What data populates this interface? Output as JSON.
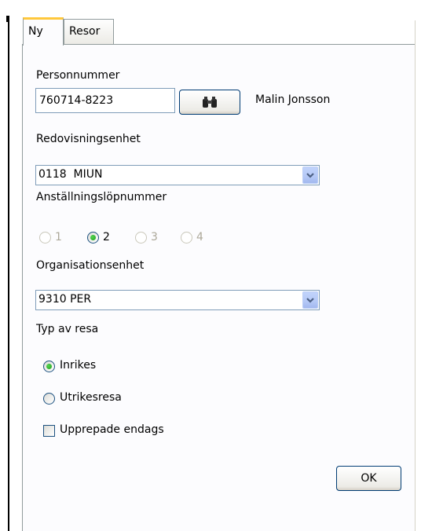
{
  "tabs": [
    {
      "label": "Ny"
    },
    {
      "label": "Resor"
    }
  ],
  "form": {
    "personnummer_label": "Personnummer",
    "personnummer_value": "760714-8223",
    "search_icon": "binoculars-icon",
    "person_name": "Malin Jonsson",
    "redovisningsenhet_label": "Redovisningsenhet",
    "redovisningsenhet_value": "0118  MIUN",
    "anstallning_label": "Anställningslöpnummer",
    "anstallning_options": [
      {
        "label": "1",
        "selected": false,
        "enabled": false
      },
      {
        "label": "2",
        "selected": true,
        "enabled": true
      },
      {
        "label": "3",
        "selected": false,
        "enabled": false
      },
      {
        "label": "4",
        "selected": false,
        "enabled": false
      }
    ],
    "organisationsenhet_label": "Organisationsenhet",
    "organisationsenhet_value": "9310 PER",
    "typ_av_resa_label": "Typ av resa",
    "typ_options": [
      {
        "label": "Inrikes",
        "selected": true
      },
      {
        "label": "Utrikesresa",
        "selected": false
      }
    ],
    "upprepade_label": "Upprepade endags",
    "upprepade_checked": false,
    "ok_label": "OK"
  },
  "colors": {
    "active_tab_accent": "#ffc83c",
    "radio_dot": "#21a121",
    "combo_arrow": "#b4c8f6"
  }
}
